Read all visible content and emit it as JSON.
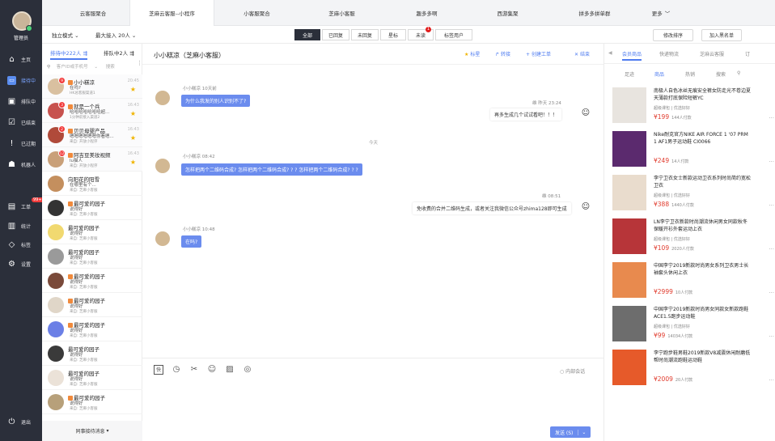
{
  "rail": {
    "username": "管理员",
    "items": [
      {
        "label": "主页",
        "icon": "home-icon"
      },
      {
        "label": "接待中",
        "icon": "chat-icon"
      },
      {
        "label": "排队中",
        "icon": "queue-icon"
      },
      {
        "label": "已结束",
        "icon": "check-icon"
      },
      {
        "label": "已过期",
        "icon": "alert-icon"
      },
      {
        "label": "机器人",
        "icon": "robot-icon"
      },
      {
        "label": "工单",
        "icon": "ticket-icon",
        "badge": "99+"
      },
      {
        "label": "统计",
        "icon": "stats-icon"
      },
      {
        "label": "标签",
        "icon": "tag-icon"
      },
      {
        "label": "设置",
        "icon": "settings-icon"
      }
    ],
    "logout": "退出"
  },
  "tabs": [
    "云客服聚合",
    "芝麻云客服--小程序",
    "小客服聚合",
    "芝麻小客服",
    "趣多多啊",
    "西游集聚",
    "拼多多拼单群",
    "更多"
  ],
  "toolbar": {
    "mode": "独立模式",
    "max_receive": "最大接入 20人",
    "filters": [
      "全部",
      "已回复",
      "未回复",
      "星标",
      "未读",
      "标签用户"
    ],
    "unread_badge": "1",
    "reorder": "修改排序",
    "blacklist": "加入黑名单"
  },
  "clist": {
    "tab_active": "排待中222人",
    "tab_queue": "排队中2人",
    "search_placeholder": "客户ID或手机号",
    "search_btn": "搜索",
    "footer": "同事接待消息",
    "items": [
      {
        "name": "小小糕凉",
        "msg": "在吗?",
        "sub": "HK总客服渠道1",
        "time": "20:45",
        "badge": "9",
        "tag": true,
        "star": true,
        "av": "#d9c0a0"
      },
      {
        "name": "就是一个兵",
        "msg": "哈哈哈哈哈哈哈超...",
        "sub": "1分钟前接入渠道2",
        "time": "16:43",
        "badge": "3",
        "tag": true,
        "star": true,
        "av": "#c7524e"
      },
      {
        "name": "贝贝母婴产品",
        "msg": "嗯嗯嗯嗯嗯嗯你看嗯...",
        "sub": "来自: 开放小程序",
        "time": "16:43",
        "badge": "2",
        "tag": true,
        "star": true,
        "av": "#b04a3a"
      },
      {
        "name": "阿吉豆美妆视频",
        "msg": "lu猫人",
        "sub": "来自: 开放小程序",
        "time": "16:43",
        "badge": "12",
        "tag": true,
        "star": true,
        "av": "#c9a079"
      },
      {
        "name": "向阳花的阳雪",
        "msg": "在哪里有个...",
        "sub": "来自: 芝麻小客服",
        "time": "",
        "badge": "",
        "tag": false,
        "star": false,
        "av": "#c48f5e"
      },
      {
        "name": "最可爱的园子",
        "msg": "说得好",
        "sub": "来自: 芝麻小客服",
        "time": "",
        "badge": "",
        "tag": true,
        "star": false,
        "av": "#333333"
      },
      {
        "name": "最可爱的园子",
        "msg": "说得好",
        "sub": "来自: 芝麻小客服",
        "time": "",
        "badge": "",
        "tag": false,
        "star": false,
        "av": "#f1d970"
      },
      {
        "name": "最可爱的园子",
        "msg": "说得好",
        "sub": "来自: 芝麻小客服",
        "time": "",
        "badge": "",
        "tag": false,
        "star": false,
        "av": "#9a9a9a"
      },
      {
        "name": "最可爱的园子",
        "msg": "说得好",
        "sub": "来自: 芝麻小客服",
        "time": "",
        "badge": "",
        "tag": true,
        "star": false,
        "av": "#7a4a3a"
      },
      {
        "name": "最可爱的园子",
        "msg": "说得好",
        "sub": "来自: 芝麻小客服",
        "time": "",
        "badge": "",
        "tag": true,
        "star": false,
        "av": "#e0d6c8"
      },
      {
        "name": "最可爱的园子",
        "msg": "说得好",
        "sub": "来自: 芝麻小客服",
        "time": "",
        "badge": "",
        "tag": true,
        "star": false,
        "av": "#6b7fe6"
      },
      {
        "name": "最可爱的园子",
        "msg": "说得好",
        "sub": "来自: 芝麻小客服",
        "time": "",
        "badge": "",
        "tag": false,
        "star": false,
        "av": "#3a3a3a"
      },
      {
        "name": "最可爱的园子",
        "msg": "说得好",
        "sub": "来自: 芝麻小客服",
        "time": "",
        "badge": "",
        "tag": false,
        "star": false,
        "av": "#ebe2d8"
      },
      {
        "name": "最可爱的园子",
        "msg": "说得好",
        "sub": "来自: 芝麻小客服",
        "time": "",
        "badge": "",
        "tag": true,
        "star": false,
        "av": "#b7a07a"
      }
    ]
  },
  "chat": {
    "title": "小小糕凉（芝麻小客服）",
    "actions": {
      "star": "标星",
      "forward": "转接",
      "ticket": "创建工单",
      "end": "结束"
    },
    "messages": {
      "m1_meta": "小小糕凉  10天前",
      "m1_text": "为什么我发的别人识别不了?",
      "m2_meta": "维 昨天 23:24",
      "m2_text": "再多生成几个试试看吧！！！",
      "sep": "今天",
      "m3_meta": "小小糕凉  08:42",
      "m3_text": "怎样把两个二维码合成? 怎样把两个二维码合成? ? ? 怎样把两个二维码合成? ? ?",
      "m4_meta": "维 08:51",
      "m4_text": "免收费的合并二维码生成，或者关注我微信公众号zhima128即可生成",
      "m5_meta": "小小糕凉  10:48",
      "m5_text": "在吗?"
    },
    "internal": "内部会话",
    "send": "发送 (S)"
  },
  "rpanel": {
    "tabs": [
      "会员商品",
      "快递物流",
      "芝麻云客服",
      "订"
    ],
    "subtabs": [
      "足迹",
      "商品",
      "热销",
      "搜索"
    ],
    "products": [
      {
        "title": "南极人自色冰丝无痕安全裤女防走光不卷边夏天薄款打底保险短裤YC",
        "shop": "超级课包 | 优选好好",
        "price": "¥199",
        "sold": "144人付款",
        "img": "#e8e4df"
      },
      {
        "title": "Nike耐克官方NIKE AIR FORCE 1 '07 PRM 1 AF1男子运动鞋 CI0066",
        "shop": "",
        "price": "¥249",
        "sold": "14人付款",
        "img": "#5b2a6e"
      },
      {
        "title": "李宁卫衣女士新款运动卫衣系列时尚简约宽松卫衣",
        "shop": "超级课包 | 优选好好",
        "price": "¥388",
        "sold": "1440人付款",
        "img": "#e9dccd"
      },
      {
        "title": "LN李宁卫衣新款时尚潮流休闲男女同款秋冬保暖开衫外套运动上衣",
        "shop": "超级课包 | 优选好好",
        "price": "¥109",
        "sold": "2020人付款",
        "img": "#b73539"
      },
      {
        "title": "中国李宁2019新款时尚男女系列卫衣男士长袖套头休闲上衣",
        "shop": "",
        "price": "¥2999",
        "sold": "10人付款",
        "img": "#e88a4e"
      },
      {
        "title": "中国李宁2019新款时尚男女同款女新款跑鞋ACE1.5跑步运动鞋",
        "shop": "超级课包 | 优选好好",
        "price": "¥99",
        "sold": "14034人付款",
        "img": "#6d6d6d"
      },
      {
        "title": "李宁跑步鞋男鞋2019新款V8减震休闲耐磨低帮时尚潮流跑鞋运动鞋",
        "shop": "",
        "price": "¥2009",
        "sold": "20人付款",
        "img": "#e65a2a"
      }
    ]
  }
}
